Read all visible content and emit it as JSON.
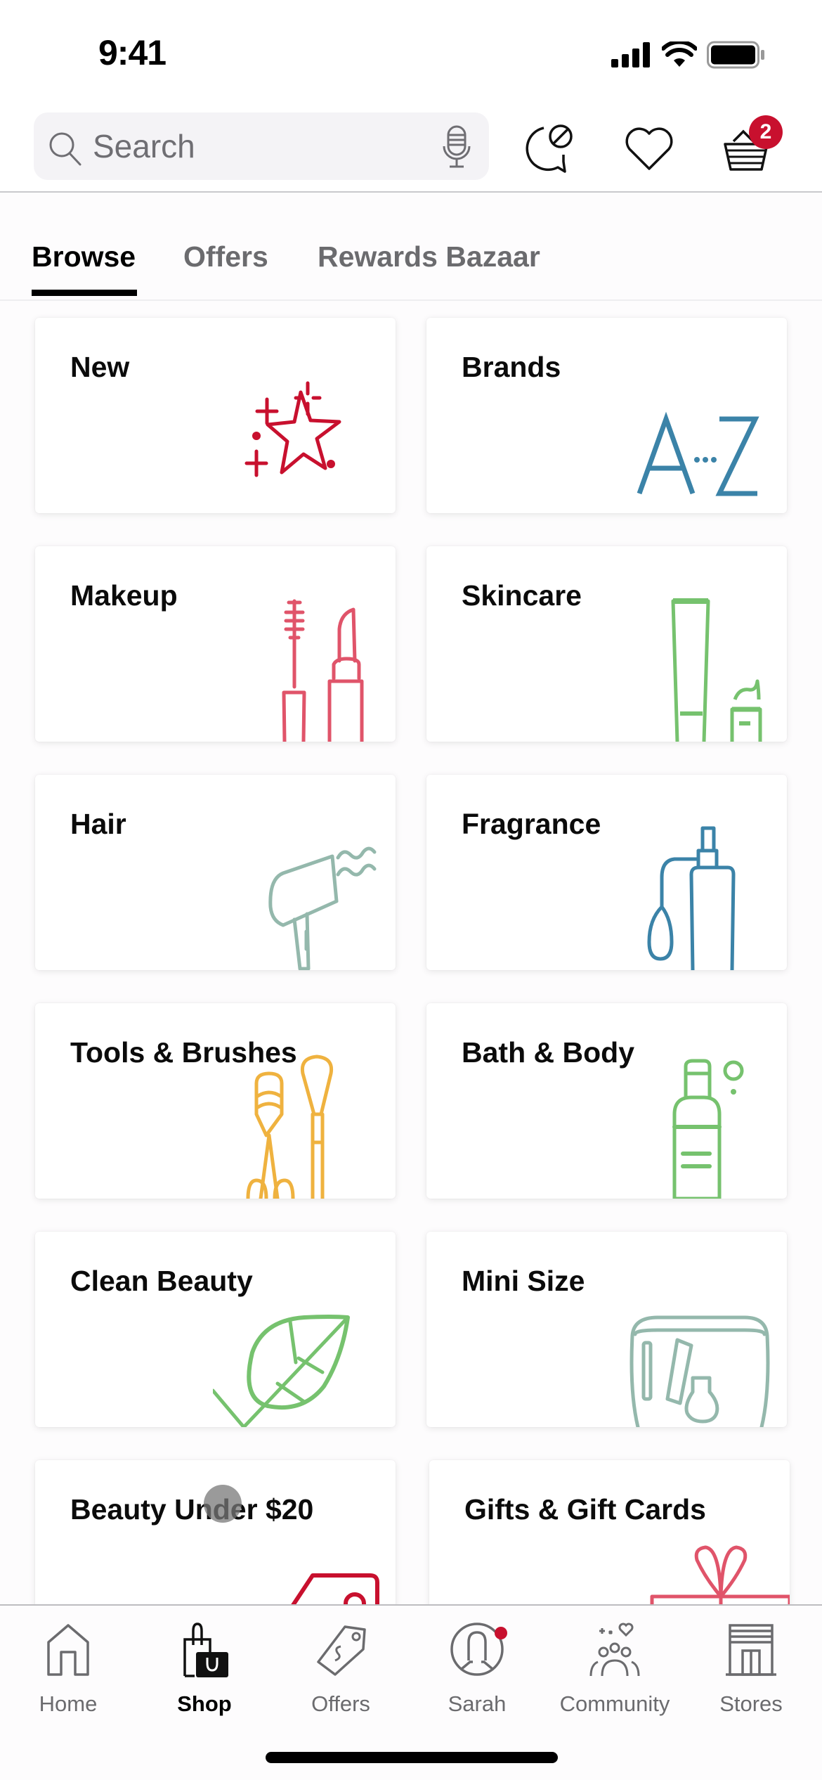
{
  "status_bar": {
    "time": "9:41",
    "icons": [
      "cellular-signal-icon",
      "wifi-icon",
      "battery-icon"
    ]
  },
  "header": {
    "search": {
      "placeholder": "Search",
      "value": ""
    },
    "icons": {
      "search": "search-icon",
      "mic": "microphone-icon",
      "chat": "chat-icon",
      "favorites": "heart-icon",
      "basket": "basket-icon"
    },
    "basket_count": "2"
  },
  "tabs": [
    {
      "label": "Browse",
      "active": true
    },
    {
      "label": "Offers",
      "active": false
    },
    {
      "label": "Rewards Bazaar",
      "active": false
    }
  ],
  "categories": [
    {
      "title": "New",
      "icon": "sparkle-star-icon",
      "color": "#c8102e"
    },
    {
      "title": "Brands",
      "icon": "a-to-z-icon",
      "color": "#3b83a8"
    },
    {
      "title": "Makeup",
      "icon": "mascara-lipstick-icon",
      "color": "#e0546a"
    },
    {
      "title": "Skincare",
      "icon": "tube-jar-icon",
      "color": "#76c26e"
    },
    {
      "title": "Hair",
      "icon": "hair-dryer-icon",
      "color": "#94b8ac"
    },
    {
      "title": "Fragrance",
      "icon": "perfume-bottle-icon",
      "color": "#3b83a8"
    },
    {
      "title": "Tools & Brushes",
      "icon": "curler-brush-icon",
      "color": "#efb23f"
    },
    {
      "title": "Bath & Body",
      "icon": "body-wash-bottle-icon",
      "color": "#76c26e"
    },
    {
      "title": "Clean Beauty",
      "icon": "leaf-check-icon",
      "color": "#76c26e"
    },
    {
      "title": "Mini Size",
      "icon": "travel-bag-icon",
      "color": "#94b8ac"
    },
    {
      "title": "Beauty Under $20",
      "icon": "price-tag-icon",
      "color": "#c8102e"
    },
    {
      "title": "Gifts & Gift Cards",
      "icon": "gift-box-icon",
      "color": "#e0546a"
    }
  ],
  "tabbar": [
    {
      "label": "Home",
      "icon": "home-icon",
      "active": false
    },
    {
      "label": "Shop",
      "icon": "shopping-bag-icon",
      "active": true
    },
    {
      "label": "Offers",
      "icon": "price-tag-icon",
      "active": false
    },
    {
      "label": "Sarah",
      "icon": "profile-icon",
      "active": false,
      "notification": true
    },
    {
      "label": "Community",
      "icon": "community-icon",
      "active": false
    },
    {
      "label": "Stores",
      "icon": "store-icon",
      "active": false
    }
  ],
  "colors": {
    "accent": "#c8102e",
    "text_primary": "#000000",
    "text_secondary": "#6b6b6e"
  }
}
